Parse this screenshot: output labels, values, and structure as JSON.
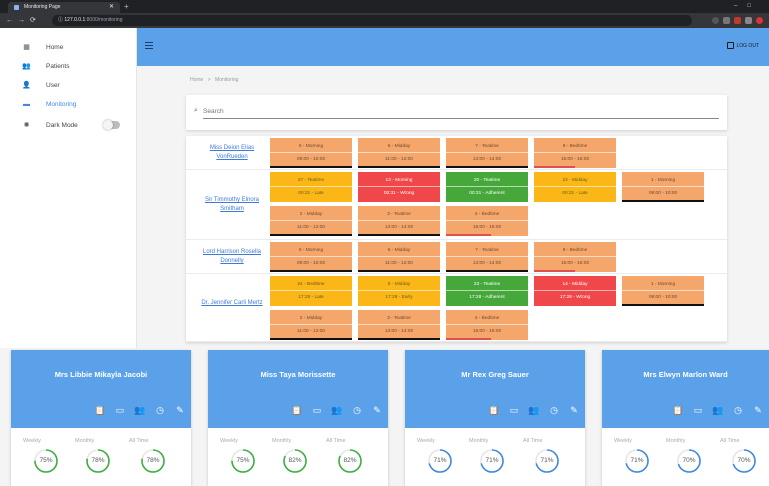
{
  "browser": {
    "tab_title": "Monitoring Page",
    "url_host": "127.0.0.1",
    "url_path": ":8000/monitoring"
  },
  "sidebar": {
    "items": [
      {
        "label": "Home",
        "icon": "dashboard-icon"
      },
      {
        "label": "Patients",
        "icon": "people-icon"
      },
      {
        "label": "User",
        "icon": "person-icon"
      },
      {
        "label": "Monitoring",
        "icon": "monitor-icon",
        "active": true
      },
      {
        "label": "Dark Mode",
        "icon": "sun-icon",
        "toggle": false
      }
    ]
  },
  "appbar": {
    "logout_label": "LOG OUT"
  },
  "breadcrumb": {
    "home": "Home",
    "sep": ">",
    "current": "Monitoring"
  },
  "search": {
    "placeholder": "Search"
  },
  "schedule": [
    {
      "patient": "Miss Deion Elias VonRueden",
      "slots": [
        {
          "label": "5 - Morning",
          "time": "09:00 - 10:00",
          "status": "pending",
          "progress": 1.0
        },
        {
          "label": "6 - Midday",
          "time": "11:00 - 12:00",
          "status": "pending",
          "progress": 1.0
        },
        {
          "label": "7 - Teatime",
          "time": "13:00 - 14:00",
          "status": "pending",
          "progress": 1.0
        },
        {
          "label": "8 - Bedtime",
          "time": "15:00 - 16:00",
          "status": "pending",
          "progress": 0.5
        }
      ]
    },
    {
      "patient": "Sir Timmothy Elnora Smitham",
      "slots": [
        {
          "label": "27 - Teatime",
          "time": "00:31 - Late",
          "status": "late"
        },
        {
          "label": "13 - Morning",
          "time": "00:31 - Wrong",
          "status": "wrong"
        },
        {
          "label": "20 - Teatime",
          "time": "00:31 - Adherent",
          "status": "adherent"
        },
        {
          "label": "22 - Midday",
          "time": "00:31 - Late",
          "status": "late"
        },
        {
          "label": "1 - Morning",
          "time": "09:00 - 10:00",
          "status": "pending",
          "progress": 1.0
        },
        {
          "label": "2 - Midday",
          "time": "11:00 - 12:00",
          "status": "pending",
          "progress": 1.0
        },
        {
          "label": "3 - Teatime",
          "time": "13:00 - 14:00",
          "status": "pending",
          "progress": 1.0
        },
        {
          "label": "4 - Bedtime",
          "time": "15:00 - 16:00",
          "status": "pending",
          "progress": 0.55
        }
      ]
    },
    {
      "patient": "Lord Harrison Rosella Donnelly",
      "slots": [
        {
          "label": "5 - Morning",
          "time": "09:00 - 10:00",
          "status": "pending",
          "progress": 1.0
        },
        {
          "label": "6 - Midday",
          "time": "11:00 - 12:00",
          "status": "pending",
          "progress": 1.0
        },
        {
          "label": "7 - Teatime",
          "time": "13:00 - 14:00",
          "status": "pending",
          "progress": 1.0
        },
        {
          "label": "8 - Bedtime",
          "time": "15:00 - 16:00",
          "status": "pending",
          "progress": 0.5
        }
      ]
    },
    {
      "patient": "Dr. Jennifer Carli Mertz",
      "slots": [
        {
          "label": "24 - Bedtime",
          "time": "17:28 - Late",
          "status": "late"
        },
        {
          "label": "5 - Midday",
          "time": "17:28 - Early",
          "status": "early"
        },
        {
          "label": "23 - Teatime",
          "time": "17:28 - Adherent",
          "status": "adherent"
        },
        {
          "label": "14 - Midday",
          "time": "17:28 - Wrong",
          "status": "wrong"
        },
        {
          "label": "1 - Morning",
          "time": "09:00 - 10:00",
          "status": "pending",
          "progress": 1.0
        },
        {
          "label": "2 - Midday",
          "time": "11:00 - 12:00",
          "status": "pending",
          "progress": 1.0
        },
        {
          "label": "3 - Teatime",
          "time": "13:00 - 14:00",
          "status": "pending",
          "progress": 1.0
        },
        {
          "label": "4 - Bedtime",
          "time": "15:00 - 16:00",
          "status": "pending",
          "progress": 0.55
        }
      ]
    }
  ],
  "patient_cards": [
    {
      "name": "Mrs Libbie Mikayla Jacobi",
      "weekly": "75%",
      "monthly": "78%",
      "all_time": "78%",
      "w": 0.75,
      "m": 0.78,
      "a": 0.78
    },
    {
      "name": "Miss Taya Morissette",
      "weekly": "75%",
      "monthly": "82%",
      "all_time": "82%",
      "w": 0.75,
      "m": 0.82,
      "a": 0.82
    },
    {
      "name": "Mr Rex Greg Sauer",
      "weekly": "71%",
      "monthly": "71%",
      "all_time": "71%",
      "w": 0.71,
      "m": 0.71,
      "a": 0.71
    },
    {
      "name": "Mrs Elwyn Marlon Ward",
      "weekly": "71%",
      "monthly": "70%",
      "all_time": "70%",
      "w": 0.71,
      "m": 0.7,
      "a": 0.7
    }
  ],
  "card_labels": {
    "weekly": "Weekly",
    "monthly": "Monthly",
    "all_time": "All Time"
  },
  "colors": {
    "primary": "#5aa1ea",
    "pending": "#f5a66a",
    "late": "#fbb718",
    "wrong": "#f0484a",
    "adherent": "#46a83a",
    "ring_green": "#3cb043",
    "ring_blue": "#3f8ae0"
  }
}
